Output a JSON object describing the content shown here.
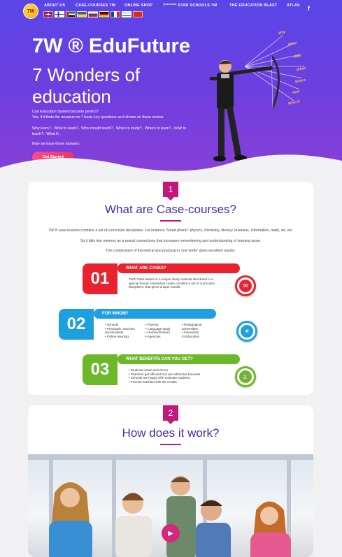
{
  "brand": {
    "logo_text": "7W"
  },
  "nav": {
    "items": [
      "ABOUT US",
      "CASE-COURSES 7W",
      "ONLINE SHOP",
      "7******* STAR SCHOOLS 7W",
      "THE EDUCATION BLAST",
      "ATLAS"
    ],
    "facebook_icon": "f"
  },
  "hero": {
    "title": "7W ® EduFuture",
    "subtitle": "7 Wonders of education",
    "question": "Can Education System become perfect?",
    "question2": "Yes, if it finds the answers on 7 basic key questions as it shown on these arrows",
    "why": "Why learn?.. What to learn?.. Who should teach?.. When to study?.. Where to learn?.. hoW to teach?.. What if...",
    "now": "Now we have these answers.",
    "cta": "Get Started",
    "arrow_labels": [
      "Why",
      "What",
      "Who",
      "When",
      "Where",
      "How",
      "What if"
    ]
  },
  "section1": {
    "badge": "1",
    "title": "What are Case-courses?",
    "p1": "7W ® case-lessons combine a set of curriculum disciplines. For instance 'Smart phone': physics, chemistry, literacy, business, information, math, art, etc.",
    "p2": "So it falls into memory as a neural connections that increases remembering and understanding of learning issue.",
    "p3": "The combination of theoretical and practical in 'one bottle' gives excellent results.",
    "rows": [
      {
        "num": "01",
        "heading": "WHAT ARE CASES?",
        "text": "7W® Case-lesson is a unique study material structured in a special format. Interactive cases combine a set of curriculum disciplines, that gives unique results."
      },
      {
        "num": "02",
        "heading": "FOR WHOM?",
        "col1": [
          "• Schools",
          "• Principals, teachers",
          "  and students",
          "• Online learning"
        ],
        "col2": [
          "• Parents",
          "• Language study",
          "• Homeschoolers",
          "• Agencies"
        ],
        "col3": [
          "• Pedagogical",
          "  universities",
          "• Innovators",
          "  in Education"
        ]
      },
      {
        "num": "03",
        "heading": "WHAT BENEFITS CAN YOU GET?",
        "items": [
          "• Students smart and clever",
          "• Teachers get efficient tool and attractive bonuses",
          "• Schools are happy with motivate students",
          "• Parents satisfied with the results"
        ]
      }
    ]
  },
  "section2": {
    "badge": "2",
    "title": "How does it work?"
  },
  "colors": {
    "red": "#e8232f",
    "blue": "#1e9fe0",
    "green": "#6cb82a",
    "magenta": "#c3177b",
    "purple": "#4a2aa8"
  }
}
